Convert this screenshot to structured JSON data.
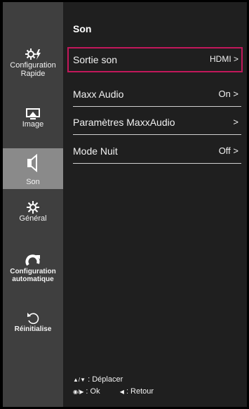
{
  "sidebar": {
    "items": [
      {
        "name": "quick-settings",
        "label": "Configuration\nRapide",
        "icon": "quick-settings-icon"
      },
      {
        "name": "picture",
        "label": "Image",
        "icon": "monitor-icon"
      },
      {
        "name": "sound",
        "label": "Son",
        "icon": "speaker-icon",
        "active": true
      },
      {
        "name": "general",
        "label": "Général",
        "icon": "gear-icon"
      },
      {
        "name": "auto-config",
        "label": "Configuration\nautomatique",
        "icon": "auto-config-icon"
      },
      {
        "name": "reset",
        "label": "Réinitialise",
        "icon": "reset-icon"
      }
    ]
  },
  "main": {
    "title": "Son",
    "rows": [
      {
        "label": "Sortie son",
        "value": "HDMI >",
        "selected": true
      },
      {
        "label": "Maxx Audio",
        "value": "On >"
      },
      {
        "label": "Paramètres MaxxAudio",
        "value": ">"
      },
      {
        "label": "Mode Nuit",
        "value": "Off >"
      }
    ]
  },
  "hints": {
    "move_keys": "▲/▼",
    "move_label": ": Déplacer",
    "ok_keys": "◉/▶",
    "ok_label": ": Ok",
    "back_key": "◀",
    "back_label": ": Retour"
  },
  "colors": {
    "selection_border": "#c2185b",
    "active_sidebar": "#8a8a8a",
    "sidebar_bg": "#3f3f3f",
    "panel_bg": "#1f1f1f"
  }
}
